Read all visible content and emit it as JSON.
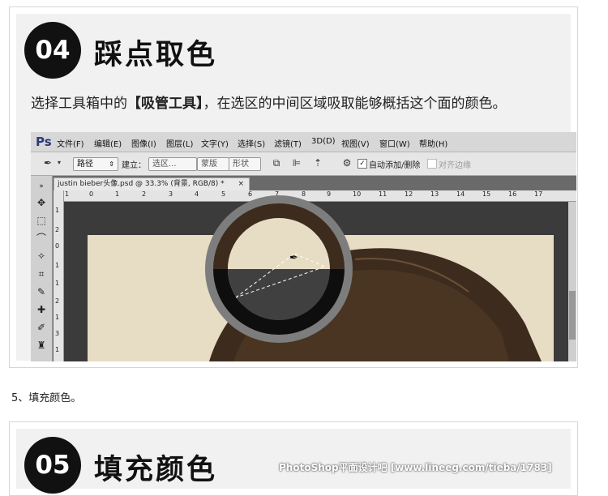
{
  "step1": {
    "number": "04",
    "title": "踩点取色",
    "desc_before": "选择工具箱中的",
    "desc_bold": "【吸管工具】",
    "desc_after": "，在选区的中间区域吸取能够概括这个面的颜色。"
  },
  "ps": {
    "logo": "Ps",
    "menus": [
      "文件(F)",
      "编辑(E)",
      "图像(I)",
      "图层(L)",
      "文字(Y)",
      "选择(S)",
      "滤镜(T)",
      "3D(D)",
      "视图(V)",
      "窗口(W)",
      "帮助(H)"
    ],
    "options": {
      "mode_select": "路径",
      "create_label": "建立：",
      "btn_selection": "选区...",
      "btn_mask": "蒙版",
      "btn_shape": "形状",
      "auto_add_delete": "自动添加/删除",
      "align_edges": "对齐边缘"
    },
    "doc_tab": "justin bieber头像.psd @ 33.3% (背景, RGB/8) *",
    "doc_tab_close": "×",
    "ruler_top": [
      "1",
      "0",
      "1",
      "2",
      "3",
      "4",
      "5",
      "6",
      "7",
      "8",
      "9",
      "10",
      "11",
      "12",
      "13",
      "14",
      "15",
      "16",
      "17"
    ],
    "ruler_left": [
      "1",
      "2",
      "0",
      "1",
      "1",
      "2",
      "1",
      "3",
      "1"
    ]
  },
  "note": "5、填充颜色。",
  "step2": {
    "number": "05",
    "title": "填充颜色"
  },
  "watermark": "PhotoShop平面设计吧 [www.lineeg.com/tieba/1783]",
  "colors": {
    "circle": "#111111",
    "photo_bg": "#e7dcc4",
    "hair": "#3d2c1d",
    "ring": "#7d7d7d"
  }
}
